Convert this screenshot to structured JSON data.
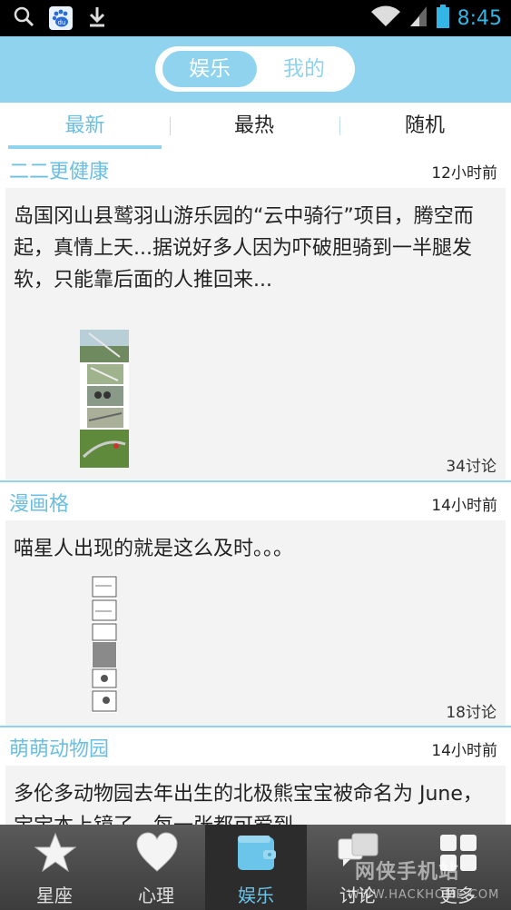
{
  "status_bar": {
    "time": "8:45",
    "icons": [
      "search-icon",
      "baidu-icon",
      "download-icon",
      "wifi-icon",
      "signal-icon",
      "battery-icon"
    ],
    "baidu_badge": "du"
  },
  "header": {
    "segments": [
      {
        "label": "娱乐",
        "selected": true
      },
      {
        "label": "我的",
        "selected": false
      }
    ]
  },
  "subtabs": [
    {
      "label": "最新",
      "selected": true
    },
    {
      "label": "最热",
      "selected": false
    },
    {
      "label": "随机",
      "selected": false
    }
  ],
  "feed": [
    {
      "source": "二二更健康",
      "time": "12小时前",
      "text": "岛国冈山县鹫羽山游乐园的“云中骑行”项目，腾空而起，真情上天...据说好多人因为吓破胆骑到一半腿发软，只能靠后面的人推回来...",
      "comments": "34讨论"
    },
    {
      "source": "漫画格",
      "time": "14小时前",
      "text": "喵星人出现的就是这么及时。。。",
      "comments": "18讨论"
    },
    {
      "source": "萌萌动物园",
      "time": "14小时前",
      "text": "多伦多动物园去年出生的北极熊宝宝被命名为 June，宝宝本上镜了，每一张都可爱到"
    }
  ],
  "bottom_nav": [
    {
      "label": "星座",
      "icon": "star-icon",
      "selected": false
    },
    {
      "label": "心理",
      "icon": "heart-icon",
      "selected": false
    },
    {
      "label": "娱乐",
      "icon": "wallet-icon",
      "selected": true
    },
    {
      "label": "讨论",
      "icon": "chat-icon",
      "selected": false
    },
    {
      "label": "更多",
      "icon": "grid-icon",
      "selected": false
    }
  ],
  "watermark": {
    "text": "网侠手机站",
    "url": "WWW.HACKHOME.COM"
  },
  "colors": {
    "accent": "#8fd3ee",
    "accent_text": "#6bbfe0",
    "status_time": "#33b5e5"
  }
}
